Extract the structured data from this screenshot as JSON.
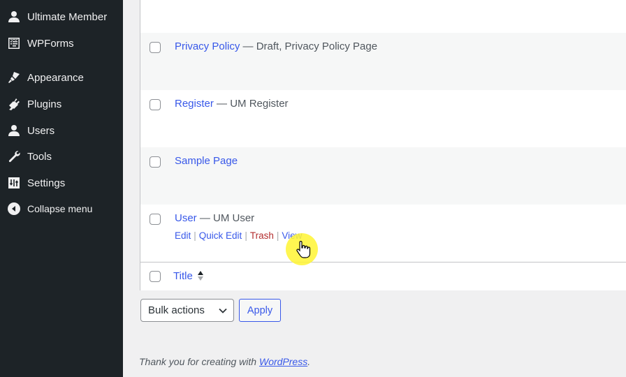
{
  "sidebar": {
    "items": [
      {
        "label": "Ultimate Member",
        "icon": "user-icon"
      },
      {
        "label": "WPForms",
        "icon": "form-icon"
      },
      {
        "label": "Appearance",
        "icon": "paintbrush-icon"
      },
      {
        "label": "Plugins",
        "icon": "plugin-icon"
      },
      {
        "label": "Users",
        "icon": "users-icon"
      },
      {
        "label": "Tools",
        "icon": "wrench-icon"
      },
      {
        "label": "Settings",
        "icon": "settings-icon"
      },
      {
        "label": "Collapse menu",
        "icon": "collapse-icon"
      }
    ]
  },
  "table": {
    "rows": [
      {
        "title": "Privacy Policy",
        "state": " — Draft, Privacy Policy Page"
      },
      {
        "title": "Register",
        "state": " — UM Register"
      },
      {
        "title": "Sample Page",
        "state": ""
      },
      {
        "title": "User",
        "state": " — UM User",
        "actions": [
          "Edit",
          "Quick Edit",
          "Trash",
          "View"
        ]
      }
    ],
    "footer_column": "Title"
  },
  "bulk": {
    "select_value": "Bulk actions",
    "apply_label": "Apply"
  },
  "footer": {
    "text": "Thank you for creating with ",
    "link": "WordPress",
    "suffix": "."
  },
  "colors": {
    "sidebar_bg": "#1d2327",
    "link": "#3858e9",
    "trash": "#b32d2e"
  }
}
